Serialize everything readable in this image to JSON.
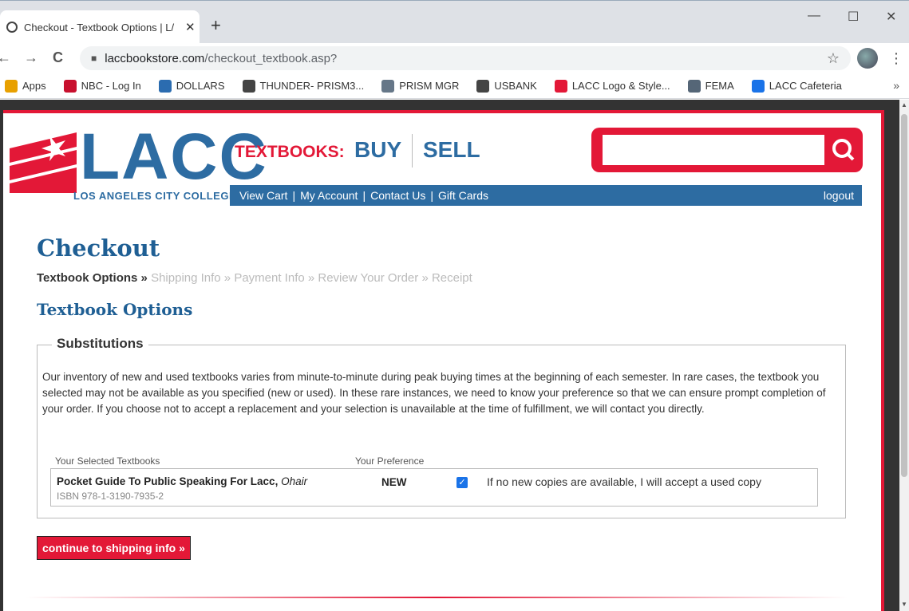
{
  "browser": {
    "tab_title": "Checkout - Textbook Options | L/",
    "tab_close": "✕",
    "new_tab": "+",
    "url_host": "laccbookstore.com",
    "url_path": "/checkout_textbook.asp?",
    "minimize": "—",
    "maximize": "☐",
    "close": "✕",
    "back": "←",
    "forward": "→",
    "reload": "C",
    "star": "☆",
    "menu": "⋮",
    "bookmarks_more": "»",
    "bookmarks": [
      {
        "label": "Apps",
        "icon": "apps-icon",
        "color": "#e8a000"
      },
      {
        "label": "NBC - Log In",
        "icon": "nbc-icon",
        "color": "#c8102e"
      },
      {
        "label": "DOLLARS",
        "icon": "dollars-icon",
        "color": "#2b6cb0"
      },
      {
        "label": "THUNDER- PRISM3...",
        "icon": "globe-icon",
        "color": "#444444"
      },
      {
        "label": "PRISM MGR",
        "icon": "prism-icon",
        "color": "#667788"
      },
      {
        "label": "USBANK",
        "icon": "globe-icon",
        "color": "#444444"
      },
      {
        "label": "LACC Logo & Style...",
        "icon": "lacc-icon",
        "color": "#e31837"
      },
      {
        "label": "FEMA",
        "icon": "fema-icon",
        "color": "#556677"
      },
      {
        "label": "LACC Cafeteria",
        "icon": "cafeteria-icon",
        "color": "#1a73e8"
      }
    ]
  },
  "header": {
    "logo_text": "LACC",
    "logo_sub": "LOS ANGELES CITY COLLEGE",
    "textbooks_label": "TEXTBOOKS:",
    "buy": "BUY",
    "sell": "SELL",
    "search_placeholder": "",
    "search_glyph": "Q",
    "nav": {
      "view_cart": "View Cart",
      "my_account": "My Account",
      "contact_us": "Contact Us",
      "gift_cards": "Gift Cards",
      "logout": "logout",
      "sep": "|"
    },
    "brand_red": "#e31837",
    "brand_blue": "#2d6ca2"
  },
  "main": {
    "title": "Checkout",
    "breadcrumb": {
      "current": "Textbook Options »",
      "rest": " Shipping Info » Payment Info » Review Your Order » Receipt"
    },
    "section_title": "Textbook Options",
    "fieldset_legend": "Substitutions",
    "description": "Our inventory of new and used textbooks varies from minute-to-minute during peak buying times at the beginning of each semester. In rare cases, the textbook you selected may not be available as you specified (new or used). In these rare instances, we need to know your preference so that we can ensure prompt completion of your order. If you choose not to accept a replacement and your selection is unavailable at the time of fulfillment, we will contact you directly.",
    "table": {
      "col_books": "Your Selected Textbooks",
      "col_pref": "Your Preference",
      "rows": [
        {
          "title": "Pocket Guide To Public Speaking For Lacc",
          "author_sep": ", ",
          "author": "Ohair",
          "isbn": "ISBN 978-1-3190-7935-2",
          "preference": "NEW",
          "accept_used_checked": true,
          "accept_used_label": "If no new copies are available, I will accept a used copy"
        }
      ]
    },
    "continue_label": "continue to shipping info »"
  }
}
